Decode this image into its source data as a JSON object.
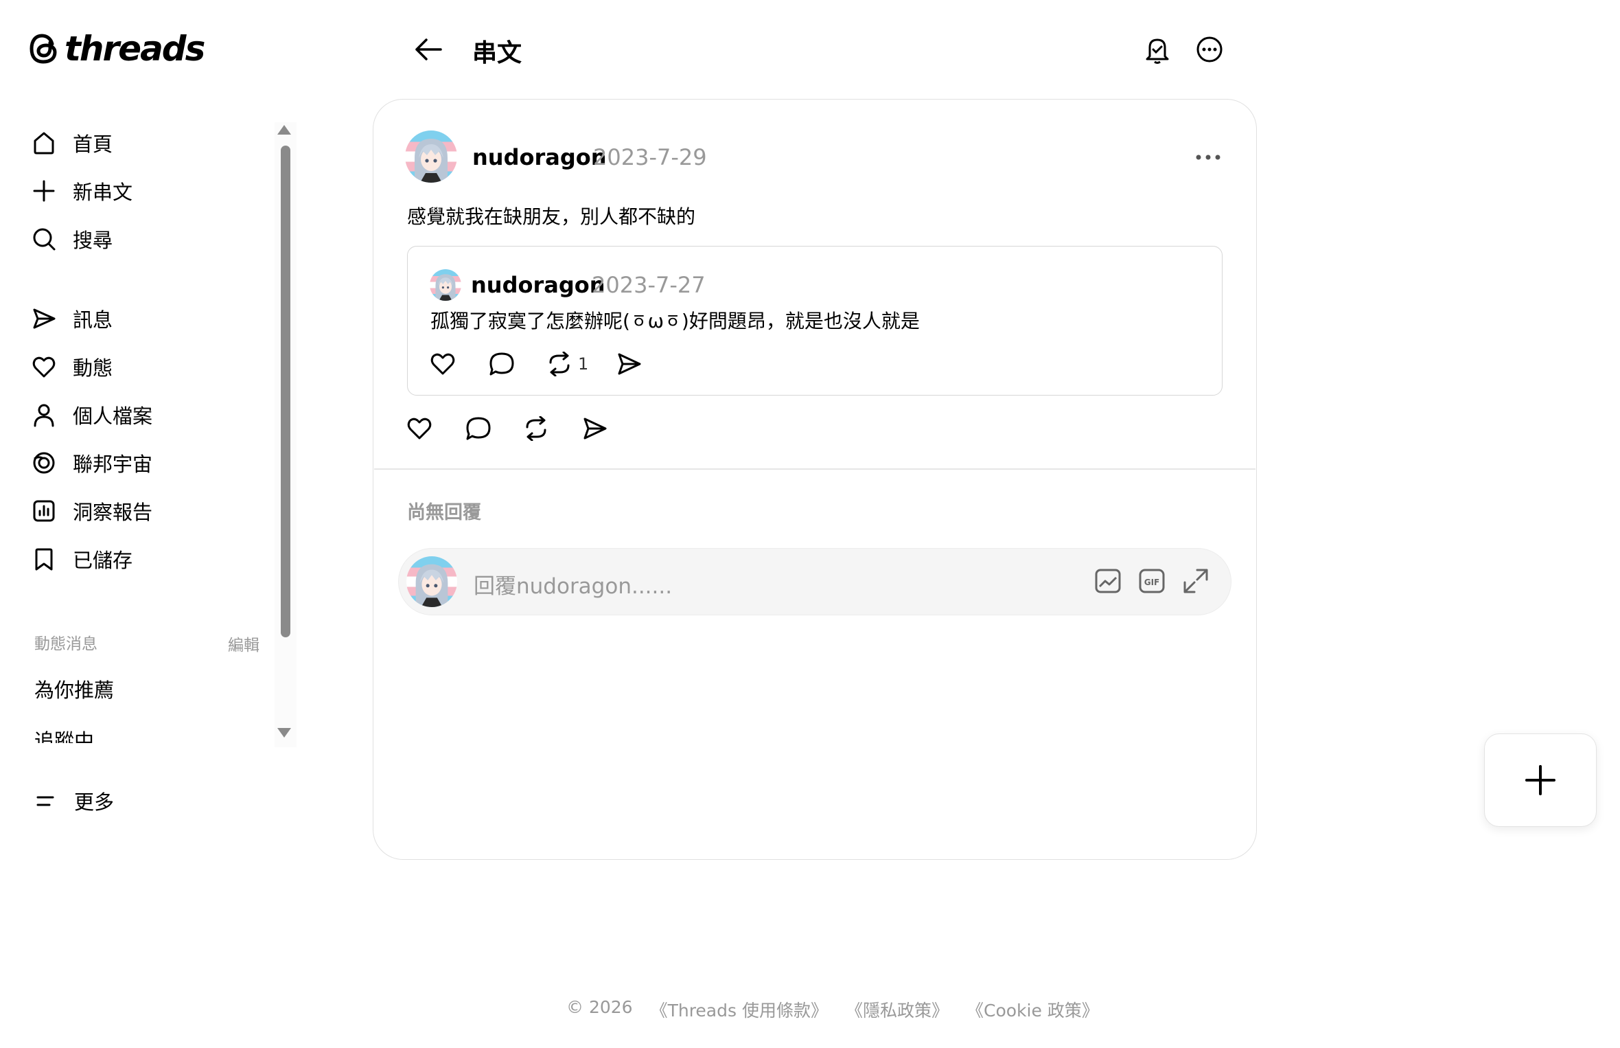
{
  "app": {
    "logo_text": "threads"
  },
  "header": {
    "title": "串文"
  },
  "sidebar": {
    "nav": [
      {
        "label": "首頁",
        "icon": "home-icon"
      },
      {
        "label": "新串文",
        "icon": "plus-icon"
      },
      {
        "label": "搜尋",
        "icon": "search-icon"
      },
      {
        "label": "訊息",
        "icon": "send-icon"
      },
      {
        "label": "動態",
        "icon": "heart-icon"
      },
      {
        "label": "個人檔案",
        "icon": "person-icon"
      },
      {
        "label": "聯邦宇宙",
        "icon": "fediverse-icon"
      },
      {
        "label": "洞察報告",
        "icon": "chart-icon"
      },
      {
        "label": "已儲存",
        "icon": "bookmark-icon"
      }
    ],
    "feeds_header": "動態消息",
    "feeds_edit": "編輯",
    "feeds": [
      "為你推薦",
      "追蹤中"
    ],
    "more_label": "更多"
  },
  "post": {
    "author": "nudoragon",
    "date": "2023-7-29",
    "text": "感覺就我在缺朋友，別人都不缺的",
    "quote": {
      "author": "nudoragon",
      "date": "2023-7-27",
      "text": "孤獨了寂寞了怎麼辦呢(ㆆωㆆ)好問題昂，就是也沒人就是",
      "repost_count": "1"
    }
  },
  "replies": {
    "empty_text": "尚無回覆",
    "placeholder": "回覆nudoragon......"
  },
  "footer": {
    "copyright": "© 2026",
    "links": [
      "《Threads 使用條款》",
      "《隱私政策》",
      "《Cookie 政策》"
    ]
  }
}
